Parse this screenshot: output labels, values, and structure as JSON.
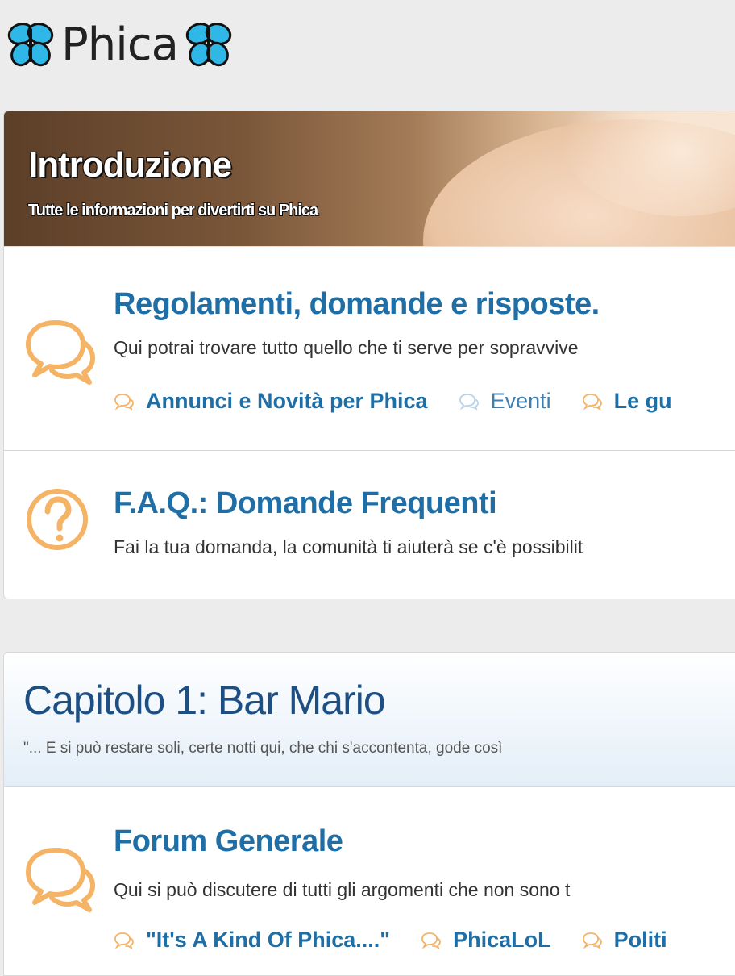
{
  "logo": {
    "text": "Phica"
  },
  "colors": {
    "link": "#1f6fa6",
    "icon": "#f5b366",
    "category_title": "#1d4f82"
  },
  "intro": {
    "title": "Introduzione",
    "subtitle": "Tutte le informazioni per divertirti su Phica"
  },
  "forums": [
    {
      "title": "Regolamenti, domande e risposte.",
      "description": "Qui potrai trovare tutto quello che ti serve per sopravvive",
      "icon": "chat-bubbles-icon",
      "sublinks": [
        {
          "label": "Annunci e Novità per Phica",
          "unread": true
        },
        {
          "label": "Eventi",
          "unread": false
        },
        {
          "label": "Le gu",
          "unread": true
        }
      ]
    },
    {
      "title": "F.A.Q.: Domande Frequenti",
      "description": "Fai la tua domanda, la comunità ti aiuterà se c'è possibilit",
      "icon": "question-circle-icon"
    }
  ],
  "category": {
    "title": "Capitolo 1: Bar Mario",
    "subtitle": "\"... E si può restare soli, certe notti qui, che chi s'accontenta, gode così",
    "forums": [
      {
        "title": "Forum Generale",
        "description": "Qui si può discutere di tutti gli argomenti che non sono t",
        "icon": "chat-bubbles-icon",
        "sublinks": [
          {
            "label": "\"It's A Kind Of Phica....\"",
            "unread": true
          },
          {
            "label": "PhicaLoL",
            "unread": true
          },
          {
            "label": "Politi",
            "unread": true
          }
        ]
      }
    ]
  }
}
